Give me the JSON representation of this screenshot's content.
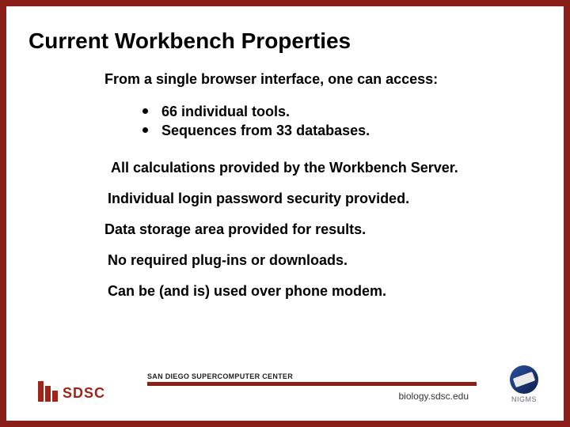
{
  "title": "Current Workbench Properties",
  "lead": "From a single browser interface, one can access:",
  "bullets": [
    "66 individual tools.",
    "Sequences from 33 databases."
  ],
  "paras": [
    "All calculations provided by the Workbench Server.",
    "Individual login password security provided.",
    "Data storage area provided for results.",
    "No required plug-ins or downloads.",
    "Can be (and is) used over phone modem."
  ],
  "footer": {
    "sdsc_logo_text": "SDSC",
    "center_title": "SAN DIEGO SUPERCOMPUTER CENTER",
    "site": "biology.sdsc.edu",
    "nigms": "NIGMS"
  },
  "colors": {
    "frame": "#8a1f1a",
    "accent": "#a02418"
  }
}
